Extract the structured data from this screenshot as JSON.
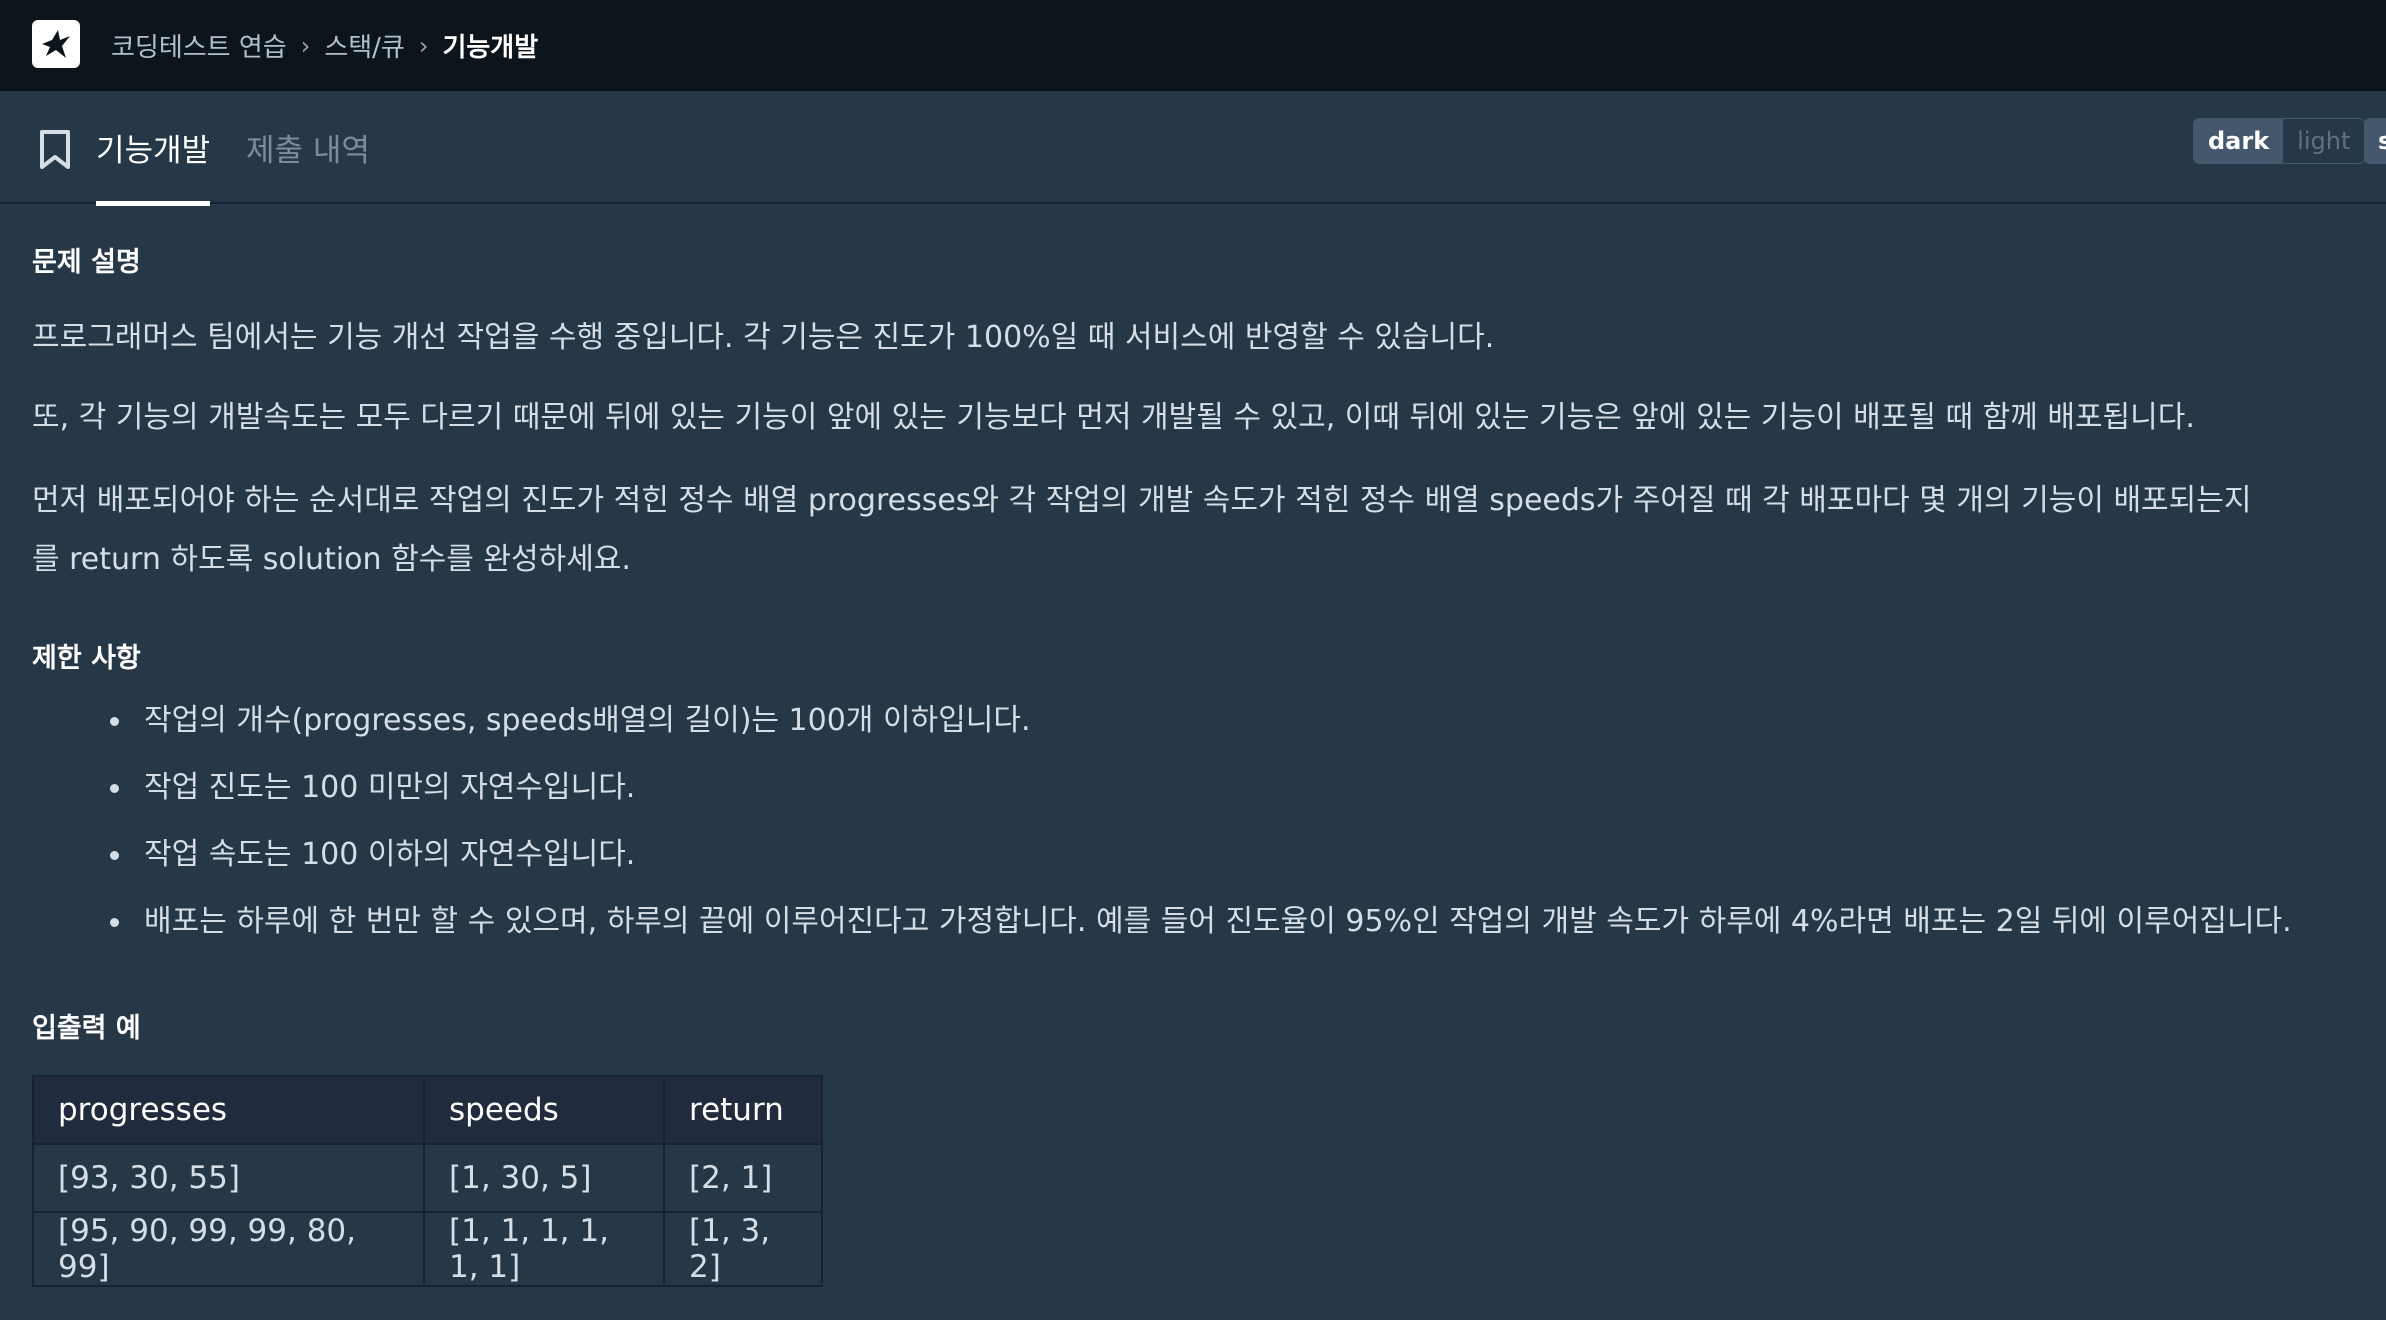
{
  "header": {
    "breadcrumb": [
      "코딩테스트 연습",
      "스택/큐",
      "기능개발"
    ],
    "breadcrumb_separator": "›"
  },
  "tabs": {
    "active": "기능개발",
    "inactive": "제출 내역"
  },
  "theme_toggle": {
    "dark": "dark",
    "light": "light",
    "extra": "s"
  },
  "problem": {
    "section_description": "문제 설명",
    "paragraphs": [
      "프로그래머스 팀에서는 기능 개선 작업을 수행 중입니다. 각 기능은 진도가 100%일 때 서비스에 반영할 수 있습니다.",
      "또, 각 기능의 개발속도는 모두 다르기 때문에 뒤에 있는 기능이 앞에 있는 기능보다 먼저 개발될 수 있고, 이때 뒤에 있는 기능은 앞에 있는 기능이 배포될 때 함께 배포됩니다.",
      "먼저 배포되어야 하는 순서대로 작업의 진도가 적힌 정수 배열 progresses와 각 작업의 개발 속도가 적힌 정수 배열 speeds가 주어질 때 각 배포마다 몇 개의 기능이 배포되는지",
      "를 return 하도록 solution 함수를 완성하세요."
    ],
    "section_limits": "제한 사항",
    "limits": [
      "작업의 개수(progresses, speeds배열의 길이)는 100개 이하입니다.",
      "작업 진도는 100 미만의 자연수입니다.",
      "작업 속도는 100 이하의 자연수입니다.",
      "배포는 하루에 한 번만 할 수 있으며, 하루의 끝에 이루어진다고 가정합니다. 예를 들어 진도율이 95%인 작업의 개발 속도가 하루에 4%라면 배포는 2일 뒤에 이루어집니다."
    ],
    "section_examples": "입출력 예",
    "examples": {
      "headers": [
        "progresses",
        "speeds",
        "return"
      ],
      "rows": [
        [
          "[93, 30, 55]",
          "[1, 30, 5]",
          "[2, 1]"
        ],
        [
          "[95, 90, 99, 99, 80, 99]",
          "[1, 1, 1, 1, 1, 1]",
          "[1, 3, 2]"
        ]
      ]
    }
  },
  "colors": {
    "background": "#263747",
    "topbar": "#0c151c",
    "text": "#d5dde6",
    "heading": "#ffffff",
    "muted_tab": "#7d8c9a"
  }
}
